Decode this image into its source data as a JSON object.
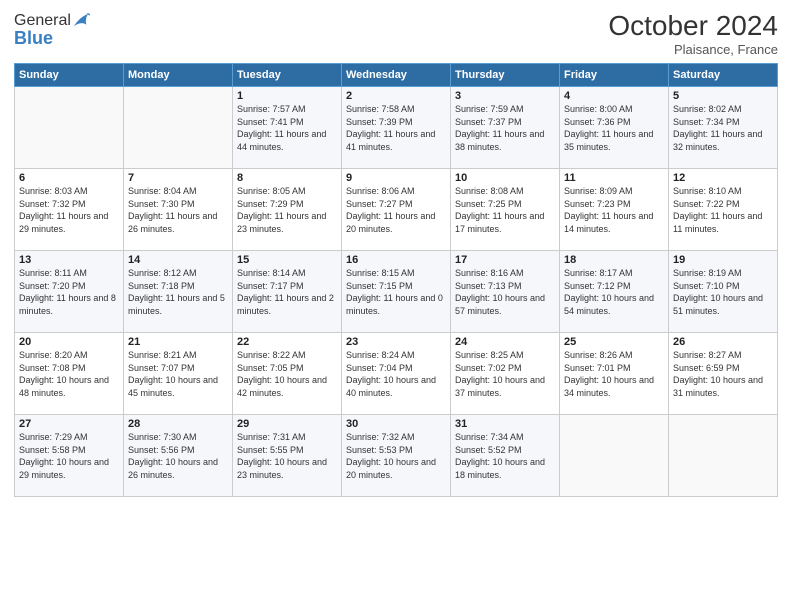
{
  "header": {
    "logo_general": "General",
    "logo_blue": "Blue",
    "month": "October 2024",
    "location": "Plaisance, France"
  },
  "days_of_week": [
    "Sunday",
    "Monday",
    "Tuesday",
    "Wednesday",
    "Thursday",
    "Friday",
    "Saturday"
  ],
  "weeks": [
    [
      {
        "day": "",
        "sunrise": "",
        "sunset": "",
        "daylight": ""
      },
      {
        "day": "",
        "sunrise": "",
        "sunset": "",
        "daylight": ""
      },
      {
        "day": "1",
        "sunrise": "Sunrise: 7:57 AM",
        "sunset": "Sunset: 7:41 PM",
        "daylight": "Daylight: 11 hours and 44 minutes."
      },
      {
        "day": "2",
        "sunrise": "Sunrise: 7:58 AM",
        "sunset": "Sunset: 7:39 PM",
        "daylight": "Daylight: 11 hours and 41 minutes."
      },
      {
        "day": "3",
        "sunrise": "Sunrise: 7:59 AM",
        "sunset": "Sunset: 7:37 PM",
        "daylight": "Daylight: 11 hours and 38 minutes."
      },
      {
        "day": "4",
        "sunrise": "Sunrise: 8:00 AM",
        "sunset": "Sunset: 7:36 PM",
        "daylight": "Daylight: 11 hours and 35 minutes."
      },
      {
        "day": "5",
        "sunrise": "Sunrise: 8:02 AM",
        "sunset": "Sunset: 7:34 PM",
        "daylight": "Daylight: 11 hours and 32 minutes."
      }
    ],
    [
      {
        "day": "6",
        "sunrise": "Sunrise: 8:03 AM",
        "sunset": "Sunset: 7:32 PM",
        "daylight": "Daylight: 11 hours and 29 minutes."
      },
      {
        "day": "7",
        "sunrise": "Sunrise: 8:04 AM",
        "sunset": "Sunset: 7:30 PM",
        "daylight": "Daylight: 11 hours and 26 minutes."
      },
      {
        "day": "8",
        "sunrise": "Sunrise: 8:05 AM",
        "sunset": "Sunset: 7:29 PM",
        "daylight": "Daylight: 11 hours and 23 minutes."
      },
      {
        "day": "9",
        "sunrise": "Sunrise: 8:06 AM",
        "sunset": "Sunset: 7:27 PM",
        "daylight": "Daylight: 11 hours and 20 minutes."
      },
      {
        "day": "10",
        "sunrise": "Sunrise: 8:08 AM",
        "sunset": "Sunset: 7:25 PM",
        "daylight": "Daylight: 11 hours and 17 minutes."
      },
      {
        "day": "11",
        "sunrise": "Sunrise: 8:09 AM",
        "sunset": "Sunset: 7:23 PM",
        "daylight": "Daylight: 11 hours and 14 minutes."
      },
      {
        "day": "12",
        "sunrise": "Sunrise: 8:10 AM",
        "sunset": "Sunset: 7:22 PM",
        "daylight": "Daylight: 11 hours and 11 minutes."
      }
    ],
    [
      {
        "day": "13",
        "sunrise": "Sunrise: 8:11 AM",
        "sunset": "Sunset: 7:20 PM",
        "daylight": "Daylight: 11 hours and 8 minutes."
      },
      {
        "day": "14",
        "sunrise": "Sunrise: 8:12 AM",
        "sunset": "Sunset: 7:18 PM",
        "daylight": "Daylight: 11 hours and 5 minutes."
      },
      {
        "day": "15",
        "sunrise": "Sunrise: 8:14 AM",
        "sunset": "Sunset: 7:17 PM",
        "daylight": "Daylight: 11 hours and 2 minutes."
      },
      {
        "day": "16",
        "sunrise": "Sunrise: 8:15 AM",
        "sunset": "Sunset: 7:15 PM",
        "daylight": "Daylight: 11 hours and 0 minutes."
      },
      {
        "day": "17",
        "sunrise": "Sunrise: 8:16 AM",
        "sunset": "Sunset: 7:13 PM",
        "daylight": "Daylight: 10 hours and 57 minutes."
      },
      {
        "day": "18",
        "sunrise": "Sunrise: 8:17 AM",
        "sunset": "Sunset: 7:12 PM",
        "daylight": "Daylight: 10 hours and 54 minutes."
      },
      {
        "day": "19",
        "sunrise": "Sunrise: 8:19 AM",
        "sunset": "Sunset: 7:10 PM",
        "daylight": "Daylight: 10 hours and 51 minutes."
      }
    ],
    [
      {
        "day": "20",
        "sunrise": "Sunrise: 8:20 AM",
        "sunset": "Sunset: 7:08 PM",
        "daylight": "Daylight: 10 hours and 48 minutes."
      },
      {
        "day": "21",
        "sunrise": "Sunrise: 8:21 AM",
        "sunset": "Sunset: 7:07 PM",
        "daylight": "Daylight: 10 hours and 45 minutes."
      },
      {
        "day": "22",
        "sunrise": "Sunrise: 8:22 AM",
        "sunset": "Sunset: 7:05 PM",
        "daylight": "Daylight: 10 hours and 42 minutes."
      },
      {
        "day": "23",
        "sunrise": "Sunrise: 8:24 AM",
        "sunset": "Sunset: 7:04 PM",
        "daylight": "Daylight: 10 hours and 40 minutes."
      },
      {
        "day": "24",
        "sunrise": "Sunrise: 8:25 AM",
        "sunset": "Sunset: 7:02 PM",
        "daylight": "Daylight: 10 hours and 37 minutes."
      },
      {
        "day": "25",
        "sunrise": "Sunrise: 8:26 AM",
        "sunset": "Sunset: 7:01 PM",
        "daylight": "Daylight: 10 hours and 34 minutes."
      },
      {
        "day": "26",
        "sunrise": "Sunrise: 8:27 AM",
        "sunset": "Sunset: 6:59 PM",
        "daylight": "Daylight: 10 hours and 31 minutes."
      }
    ],
    [
      {
        "day": "27",
        "sunrise": "Sunrise: 7:29 AM",
        "sunset": "Sunset: 5:58 PM",
        "daylight": "Daylight: 10 hours and 29 minutes."
      },
      {
        "day": "28",
        "sunrise": "Sunrise: 7:30 AM",
        "sunset": "Sunset: 5:56 PM",
        "daylight": "Daylight: 10 hours and 26 minutes."
      },
      {
        "day": "29",
        "sunrise": "Sunrise: 7:31 AM",
        "sunset": "Sunset: 5:55 PM",
        "daylight": "Daylight: 10 hours and 23 minutes."
      },
      {
        "day": "30",
        "sunrise": "Sunrise: 7:32 AM",
        "sunset": "Sunset: 5:53 PM",
        "daylight": "Daylight: 10 hours and 20 minutes."
      },
      {
        "day": "31",
        "sunrise": "Sunrise: 7:34 AM",
        "sunset": "Sunset: 5:52 PM",
        "daylight": "Daylight: 10 hours and 18 minutes."
      },
      {
        "day": "",
        "sunrise": "",
        "sunset": "",
        "daylight": ""
      },
      {
        "day": "",
        "sunrise": "",
        "sunset": "",
        "daylight": ""
      }
    ]
  ]
}
